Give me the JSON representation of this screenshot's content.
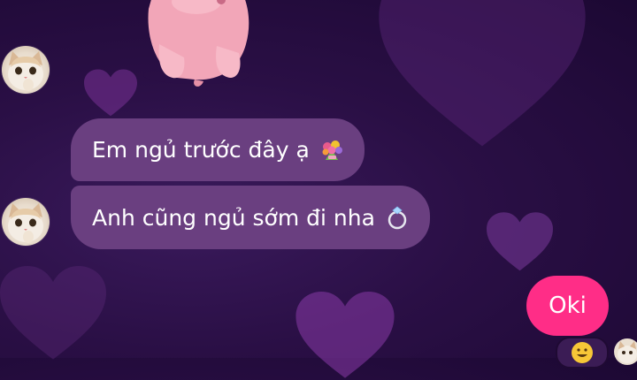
{
  "theme": {
    "background": "#2a0f45",
    "received_bubble": "#6a3f80",
    "sent_bubble": "#ff2d87"
  },
  "messages": [
    {
      "id": "msg-1",
      "direction": "received",
      "text": "Em ngủ trước đây ạ",
      "emoji": "bouquet"
    },
    {
      "id": "msg-2",
      "direction": "received",
      "text": "Anh cũng ngủ sớm đi nha",
      "emoji": "ring"
    },
    {
      "id": "msg-3",
      "direction": "sent",
      "text": "Oki",
      "reaction": "grinning-face"
    }
  ],
  "sticker": {
    "icon": "pink-cat-sticker"
  },
  "avatars": {
    "contact": "cat-avatar",
    "self": "cat-avatar"
  }
}
